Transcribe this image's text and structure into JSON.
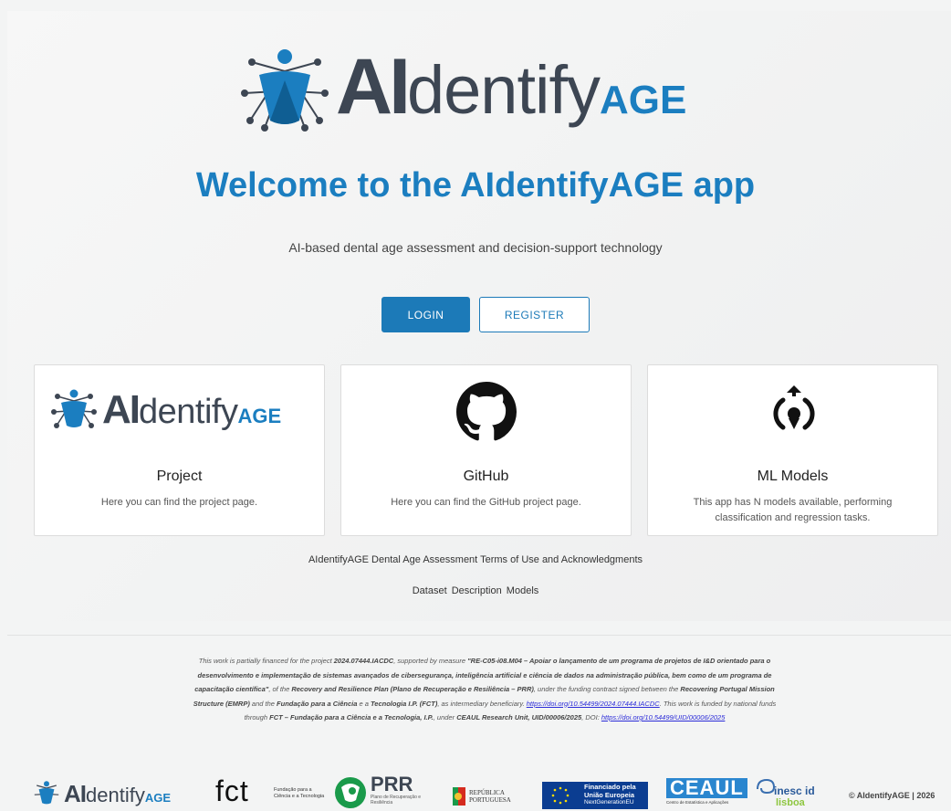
{
  "brand": {
    "ai": "AI",
    "dentify": "dentify",
    "age": "AGE",
    "accent": "#1b7ec0",
    "dark": "#3d4653"
  },
  "hero": {
    "welcome": "Welcome to the AIdentifyAGE app",
    "tagline": "AI-based dental age assessment and decision-support technology",
    "login_label": "LOGIN",
    "register_label": "REGISTER"
  },
  "cards": [
    {
      "icon": "aidentifyage-logo",
      "title": "Project",
      "desc": "Here you can find the project page."
    },
    {
      "icon": "github-icon",
      "title": "GitHub",
      "desc": "Here you can find the GitHub project page."
    },
    {
      "icon": "ml-models-icon",
      "title": "ML Models",
      "desc": "This app has N models available, performing classification and regression tasks."
    }
  ],
  "links": {
    "terms": "AIdentifyAGE Dental Age Assessment Terms of Use and Acknowledgments",
    "dataset": "Dataset",
    "description": "Description",
    "models": "Models"
  },
  "funding": {
    "t1": "This work is partially financed for the project ",
    "b1": "2024.07444.IACDC",
    "t2": ", supported by measure ",
    "b2": "\"RE-C05-i08.M04 – Apoiar o lançamento de um programa de projetos de I&D orientado para o desenvolvimento e implementação de sistemas avançados de cibersegurança, inteligência artificial e ciência de dados na administração pública, bem como de um programa de capacitação científica\"",
    "t3": ", of the ",
    "b3": "Recovery and Resilience Plan (Plano de Recuperação e Resiliência – PRR)",
    "t4": ", under the funding contract signed between the ",
    "b4": "Recovering Portugal Mission Structure (EMRP)",
    "t5": " and the ",
    "b5": "Fundação para a Ciência",
    "t6": " e a ",
    "b6": "Tecnologia I.P. (FCT)",
    "t7": ", as intermediary beneficiary. ",
    "link1": "https://doi.org/10.54499/2024.07444.IACDC",
    "t8": ". This work is funded by national funds through ",
    "b7": "FCT – Fundação para a Ciência e a Tecnologia, I.P.",
    "t9": ", under ",
    "b8": "CEAUL Research Unit, UID/00006/2025",
    "t10": ", DOI: ",
    "link2": "https://doi.org/10.54499/UID/00006/2025"
  },
  "footer": {
    "fct": "fct",
    "fct_sub": "Fundação para a Ciência e a Tecnologia",
    "prr": "PRR",
    "prr_sub": "Plano de Recuperação e Resiliência",
    "republica": "REPÚBLICA PORTUGUESA",
    "eu_line1": "Financiado pela",
    "eu_line2": "União Europeia",
    "eu_line3": "NextGenerationEU",
    "ceaul": "CEAUL",
    "ceaul_sub": "Centro de Estatística e Aplicações",
    "inesc": "inesc id",
    "lisboa": "lisboa",
    "copyright": "© AIdentifyAGE | 2026"
  }
}
